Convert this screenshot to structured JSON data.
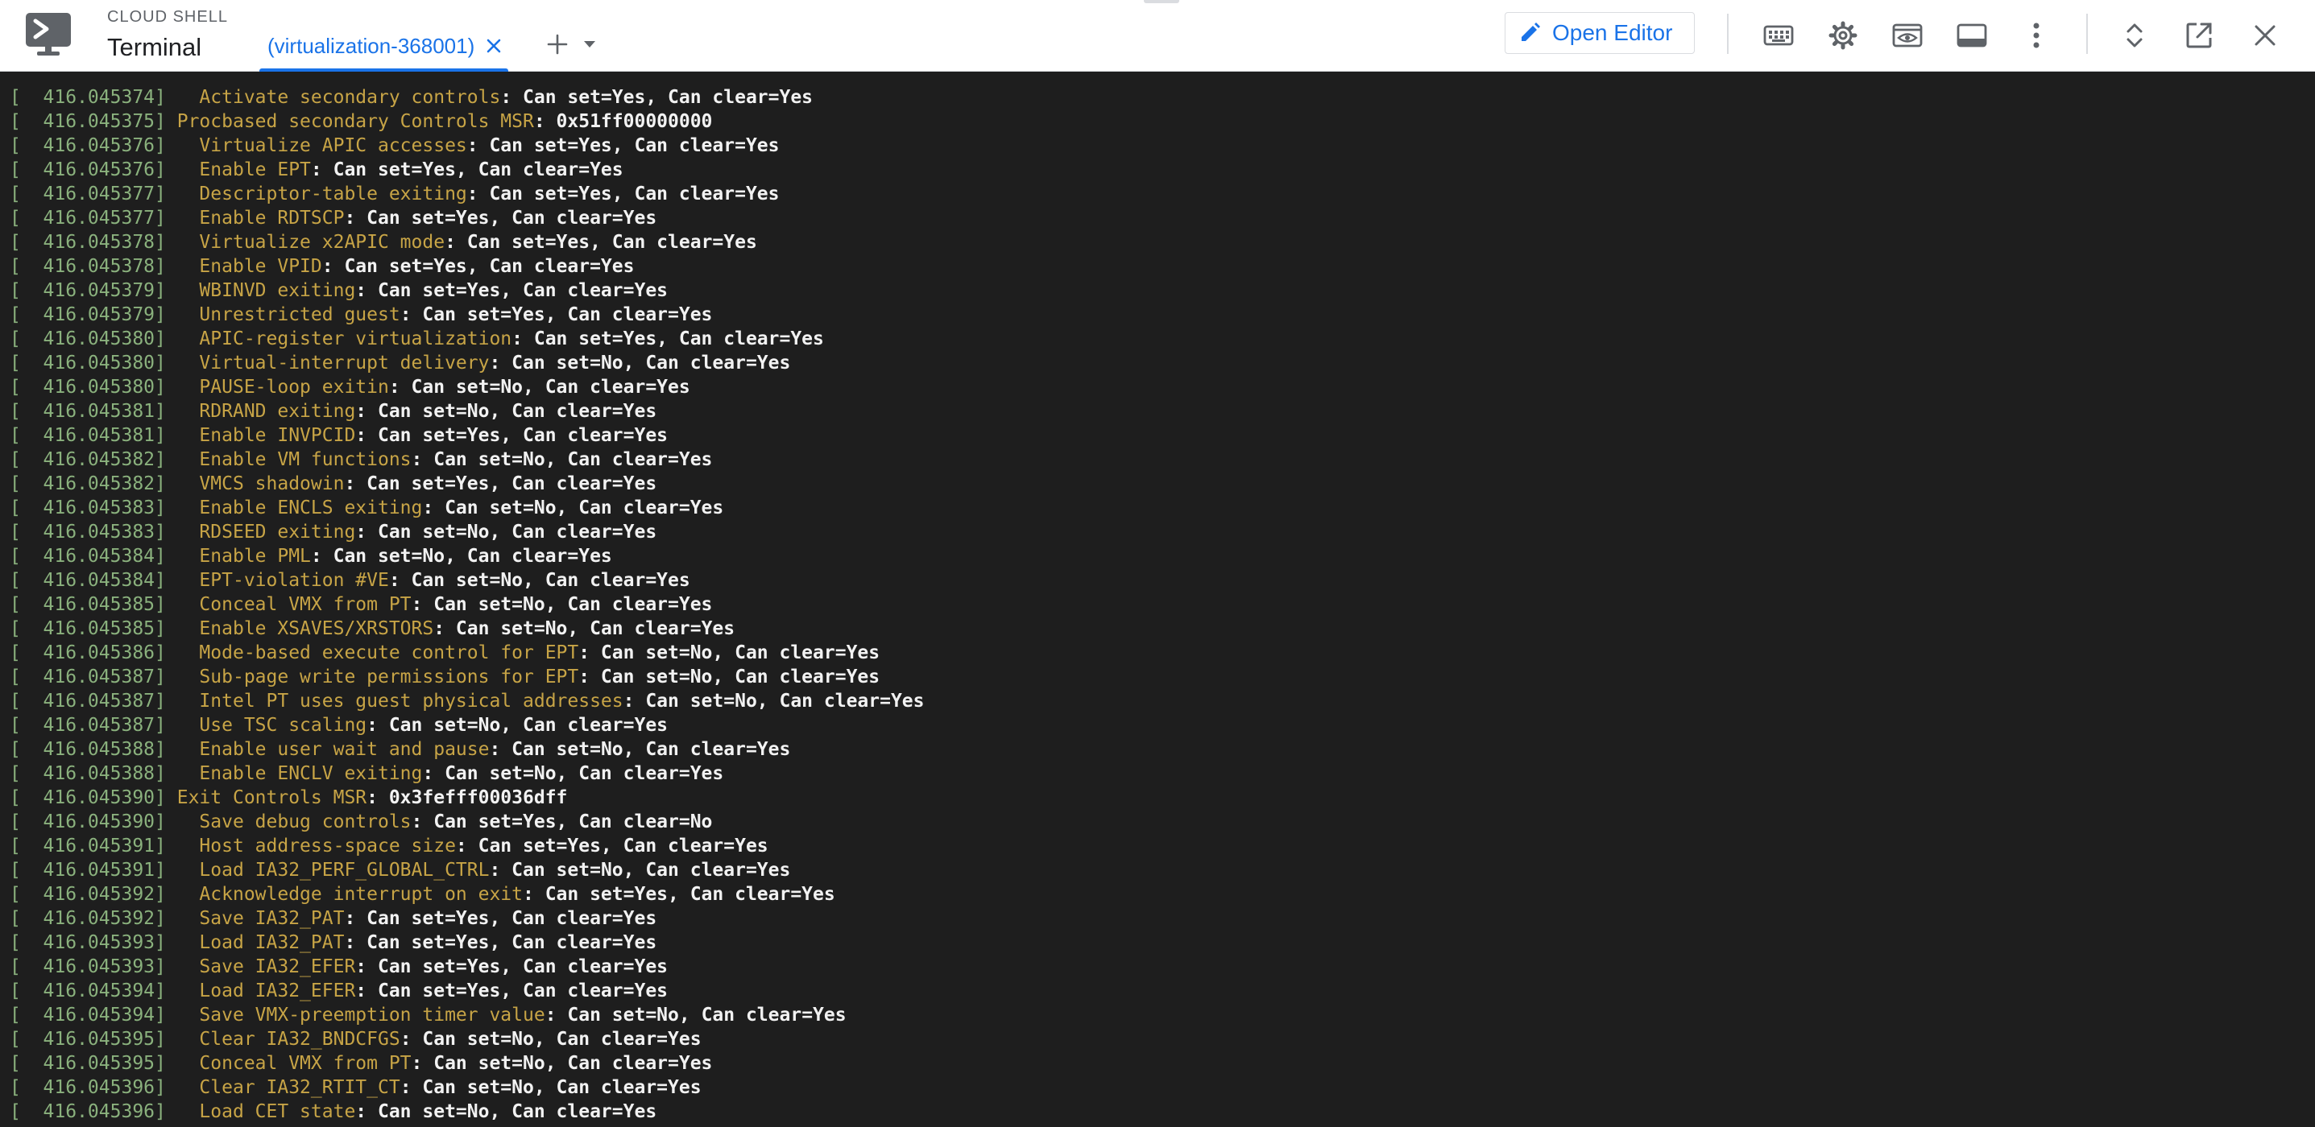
{
  "header": {
    "brand_top": "CLOUD SHELL",
    "brand_title": "Terminal",
    "tab_label": "(virtualization-368001)",
    "open_editor_label": "Open Editor"
  },
  "icons": {
    "app_logo": "terminal-icon",
    "tab_close": "close-icon",
    "add_tab": "plus-icon",
    "tab_menu": "caret-down-icon",
    "open_editor": "pencil-icon",
    "keyboard": "keyboard-icon",
    "settings": "gear-icon",
    "web_preview": "web-preview-icon",
    "layout": "panel-icon",
    "more": "more-vert-icon",
    "expand": "unfold-icon",
    "open_new_window": "open-in-new-icon",
    "close_panel": "close-icon"
  },
  "colors": {
    "accent": "#1a73e8",
    "terminal_bg": "#1e1e1e",
    "timestamp": "#8ab17d",
    "key": "#c7a446",
    "value": "#f2f2f2"
  },
  "terminal": {
    "lines": [
      {
        "ts": "[  416.045374]",
        "text": "  Activate secondary controls",
        "val": ": Can set=Yes, Can clear=Yes"
      },
      {
        "ts": "[  416.045375]",
        "text": "Procbased secondary Controls MSR",
        "val": ": 0x51ff00000000"
      },
      {
        "ts": "[  416.045376]",
        "text": "  Virtualize APIC accesses",
        "val": ": Can set=Yes, Can clear=Yes"
      },
      {
        "ts": "[  416.045376]",
        "text": "  Enable EPT",
        "val": ": Can set=Yes, Can clear=Yes"
      },
      {
        "ts": "[  416.045377]",
        "text": "  Descriptor-table exiting",
        "val": ": Can set=Yes, Can clear=Yes"
      },
      {
        "ts": "[  416.045377]",
        "text": "  Enable RDTSCP",
        "val": ": Can set=Yes, Can clear=Yes"
      },
      {
        "ts": "[  416.045378]",
        "text": "  Virtualize x2APIC mode",
        "val": ": Can set=Yes, Can clear=Yes"
      },
      {
        "ts": "[  416.045378]",
        "text": "  Enable VPID",
        "val": ": Can set=Yes, Can clear=Yes"
      },
      {
        "ts": "[  416.045379]",
        "text": "  WBINVD exiting",
        "val": ": Can set=Yes, Can clear=Yes"
      },
      {
        "ts": "[  416.045379]",
        "text": "  Unrestricted guest",
        "val": ": Can set=Yes, Can clear=Yes"
      },
      {
        "ts": "[  416.045380]",
        "text": "  APIC-register virtualization",
        "val": ": Can set=Yes, Can clear=Yes"
      },
      {
        "ts": "[  416.045380]",
        "text": "  Virtual-interrupt delivery",
        "val": ": Can set=No, Can clear=Yes"
      },
      {
        "ts": "[  416.045380]",
        "text": "  PAUSE-loop exitin",
        "val": ": Can set=No, Can clear=Yes"
      },
      {
        "ts": "[  416.045381]",
        "text": "  RDRAND exiting",
        "val": ": Can set=No, Can clear=Yes"
      },
      {
        "ts": "[  416.045381]",
        "text": "  Enable INVPCID",
        "val": ": Can set=Yes, Can clear=Yes"
      },
      {
        "ts": "[  416.045382]",
        "text": "  Enable VM functions",
        "val": ": Can set=No, Can clear=Yes"
      },
      {
        "ts": "[  416.045382]",
        "text": "  VMCS shadowin",
        "val": ": Can set=Yes, Can clear=Yes"
      },
      {
        "ts": "[  416.045383]",
        "text": "  Enable ENCLS exiting",
        "val": ": Can set=No, Can clear=Yes"
      },
      {
        "ts": "[  416.045383]",
        "text": "  RDSEED exiting",
        "val": ": Can set=No, Can clear=Yes"
      },
      {
        "ts": "[  416.045384]",
        "text": "  Enable PML",
        "val": ": Can set=No, Can clear=Yes"
      },
      {
        "ts": "[  416.045384]",
        "text": "  EPT-violation #VE",
        "val": ": Can set=No, Can clear=Yes"
      },
      {
        "ts": "[  416.045385]",
        "text": "  Conceal VMX from PT",
        "val": ": Can set=No, Can clear=Yes"
      },
      {
        "ts": "[  416.045385]",
        "text": "  Enable XSAVES/XRSTORS",
        "val": ": Can set=No, Can clear=Yes"
      },
      {
        "ts": "[  416.045386]",
        "text": "  Mode-based execute control for EPT",
        "val": ": Can set=No, Can clear=Yes"
      },
      {
        "ts": "[  416.045387]",
        "text": "  Sub-page write permissions for EPT",
        "val": ": Can set=No, Can clear=Yes"
      },
      {
        "ts": "[  416.045387]",
        "text": "  Intel PT uses guest physical addresses",
        "val": ": Can set=No, Can clear=Yes"
      },
      {
        "ts": "[  416.045387]",
        "text": "  Use TSC scaling",
        "val": ": Can set=No, Can clear=Yes"
      },
      {
        "ts": "[  416.045388]",
        "text": "  Enable user wait and pause",
        "val": ": Can set=No, Can clear=Yes"
      },
      {
        "ts": "[  416.045388]",
        "text": "  Enable ENCLV exiting",
        "val": ": Can set=No, Can clear=Yes"
      },
      {
        "ts": "[  416.045390]",
        "text": "Exit Controls MSR",
        "val": ": 0x3fefff00036dff"
      },
      {
        "ts": "[  416.045390]",
        "text": "  Save debug controls",
        "val": ": Can set=Yes, Can clear=No"
      },
      {
        "ts": "[  416.045391]",
        "text": "  Host address-space size",
        "val": ": Can set=Yes, Can clear=Yes"
      },
      {
        "ts": "[  416.045391]",
        "text": "  Load IA32_PERF_GLOBAL_CTRL",
        "val": ": Can set=No, Can clear=Yes"
      },
      {
        "ts": "[  416.045392]",
        "text": "  Acknowledge interrupt on exit",
        "val": ": Can set=Yes, Can clear=Yes"
      },
      {
        "ts": "[  416.045392]",
        "text": "  Save IA32_PAT",
        "val": ": Can set=Yes, Can clear=Yes"
      },
      {
        "ts": "[  416.045393]",
        "text": "  Load IA32_PAT",
        "val": ": Can set=Yes, Can clear=Yes"
      },
      {
        "ts": "[  416.045393]",
        "text": "  Save IA32_EFER",
        "val": ": Can set=Yes, Can clear=Yes"
      },
      {
        "ts": "[  416.045394]",
        "text": "  Load IA32_EFER",
        "val": ": Can set=Yes, Can clear=Yes"
      },
      {
        "ts": "[  416.045394]",
        "text": "  Save VMX-preemption timer value",
        "val": ": Can set=No, Can clear=Yes"
      },
      {
        "ts": "[  416.045395]",
        "text": "  Clear IA32_BNDCFGS",
        "val": ": Can set=No, Can clear=Yes"
      },
      {
        "ts": "[  416.045395]",
        "text": "  Conceal VMX from PT",
        "val": ": Can set=No, Can clear=Yes"
      },
      {
        "ts": "[  416.045396]",
        "text": "  Clear IA32_RTIT_CT",
        "val": ": Can set=No, Can clear=Yes"
      },
      {
        "ts": "[  416.045396]",
        "text": "  Load CET state",
        "val": ": Can set=No, Can clear=Yes"
      }
    ]
  }
}
